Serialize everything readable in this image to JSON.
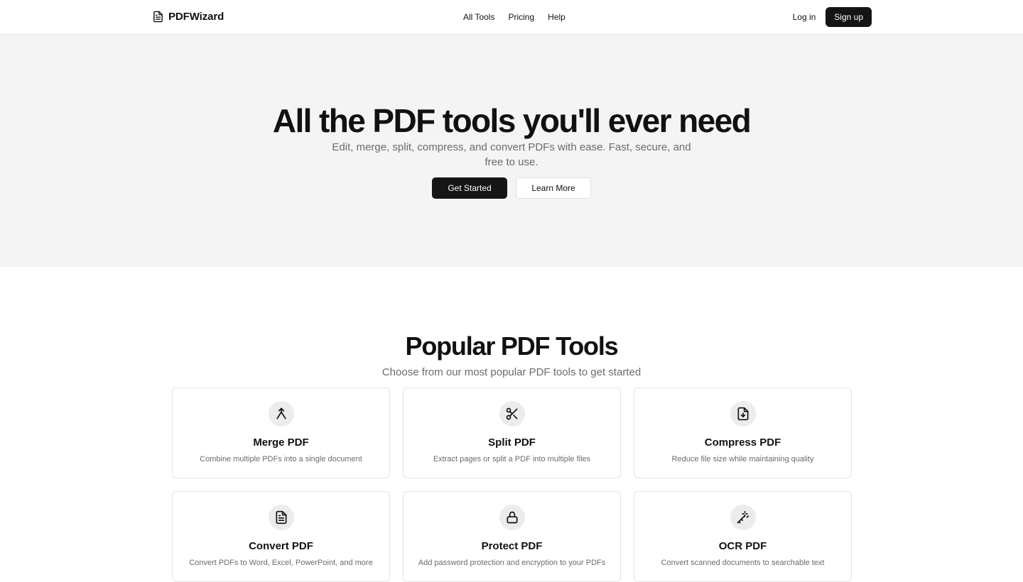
{
  "header": {
    "brand": "PDFWizard",
    "brand_icon": "file-text-icon",
    "nav": [
      "All Tools",
      "Pricing",
      "Help"
    ],
    "login": "Log in",
    "signup": "Sign up"
  },
  "hero": {
    "title": "All the PDF tools you'll ever need",
    "subtitle": "Edit, merge, split, compress, and convert PDFs with ease. Fast, secure, and free to use.",
    "primary_button": "Get Started",
    "secondary_button": "Learn More"
  },
  "tools": {
    "title": "Popular PDF Tools",
    "subtitle": "Choose from our most popular PDF tools to get started",
    "items": [
      {
        "name": "Merge PDF",
        "description": "Combine multiple PDFs into a single document",
        "icon": "merge-icon"
      },
      {
        "name": "Split PDF",
        "description": "Extract pages or split a PDF into multiple files",
        "icon": "scissors-icon"
      },
      {
        "name": "Compress PDF",
        "description": "Reduce file size while maintaining quality",
        "icon": "file-download-icon"
      },
      {
        "name": "Convert PDF",
        "description": "Convert PDFs to Word, Excel, PowerPoint, and more",
        "icon": "file-text-icon"
      },
      {
        "name": "Protect PDF",
        "description": "Add password protection and encryption to your PDFs",
        "icon": "lock-icon"
      },
      {
        "name": "OCR PDF",
        "description": "Convert scanned documents to searchable text",
        "icon": "magic-wand-icon"
      }
    ]
  },
  "colors": {
    "accent": "#151515",
    "hero_background": "#f4f4f4",
    "muted_text": "#6b6b6b",
    "border": "#e4e4e4"
  }
}
